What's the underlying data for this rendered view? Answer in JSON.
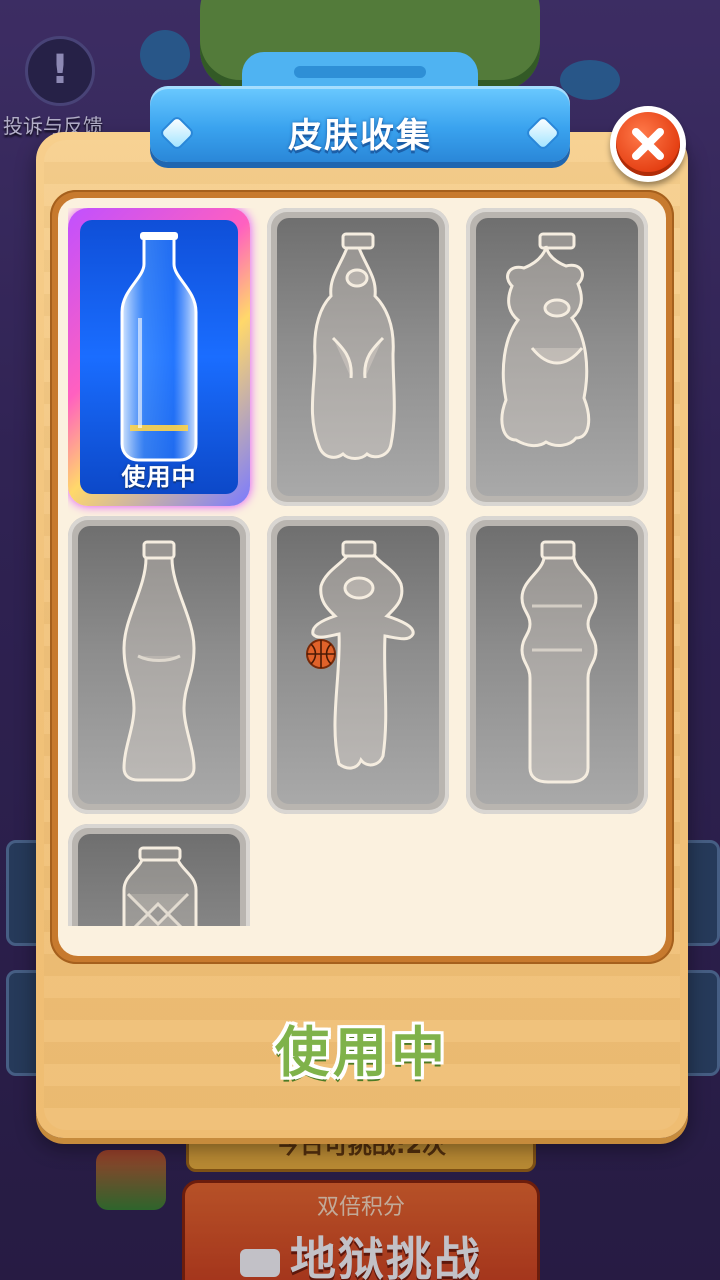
{
  "background": {
    "feedback_label": "投诉与反馈",
    "today_challenge": "今日可挑战:2次",
    "double_points": "双倍积分",
    "hell_challenge": "地狱挑战"
  },
  "dialog": {
    "title": "皮肤收集",
    "status_label": "使用中",
    "skins": [
      {
        "name": "classic-blue-bottle",
        "state": "in-use",
        "tag": "使用中"
      },
      {
        "name": "duck-bottle",
        "state": "locked"
      },
      {
        "name": "bear-bottle",
        "state": "locked"
      },
      {
        "name": "cola-bottle",
        "state": "locked"
      },
      {
        "name": "basketball-rabbit-bottle",
        "state": "locked"
      },
      {
        "name": "water-bottle",
        "state": "locked"
      },
      {
        "name": "diamond-bottle",
        "state": "locked"
      }
    ]
  },
  "colors": {
    "panel": "#f1c27a",
    "header_blue": "#3aa3ef",
    "close_red": "#e43e12",
    "status_green": "#7fb24a",
    "active_card_blue": "#1a6dff"
  }
}
